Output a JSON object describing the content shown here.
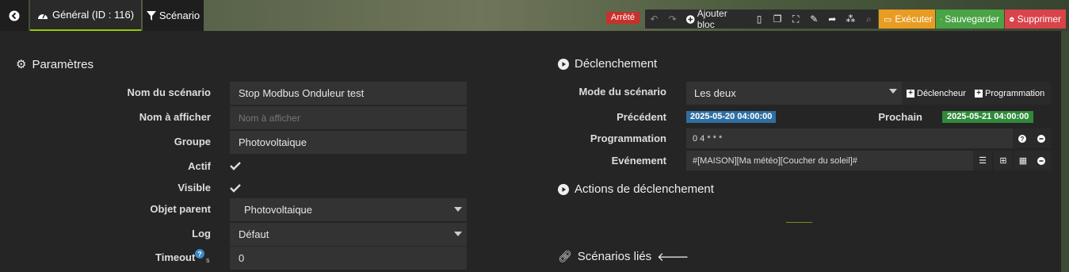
{
  "tabs": {
    "general_label": "Général (ID : 116)",
    "scenario_label": "Scénario"
  },
  "toolbar": {
    "state_badge": "Arrêté",
    "add_block_label": "Ajouter bloc",
    "execute_label": "Exécuter",
    "save_label": "Sauvegarder",
    "delete_label": "Supprimer"
  },
  "parameters": {
    "title": "Paramètres",
    "scenario_name_label": "Nom du scénario",
    "scenario_name_value": "Stop Modbus Onduleur test",
    "display_name_label": "Nom à afficher",
    "display_name_placeholder": "Nom à afficher",
    "group_label": "Groupe",
    "group_value": "Photovoltaique",
    "active_label": "Actif",
    "visible_label": "Visible",
    "parent_label": "Objet parent",
    "parent_value": "Photovoltaique",
    "log_label": "Log",
    "log_value": "Défaut",
    "timeout_label": "Timeout",
    "timeout_unit": "s",
    "timeout_value": "0"
  },
  "trigger": {
    "title": "Déclenchement",
    "mode_label": "Mode du scénario",
    "mode_value": "Les deux",
    "trigger_btn": "Déclencheur",
    "schedule_btn": "Programmation",
    "previous_label": "Précédent",
    "previous_value": "2025-05-20 04:00:00",
    "next_label": "Prochain",
    "next_value": "2025-05-21 04:00:00",
    "schedule_label": "Programmation",
    "schedule_value": "0 4 * * *",
    "event_label": "Evénement",
    "event_value": "#[MAISON][Ma météo][Coucher du soleil]#",
    "actions_title": "Actions de déclenchement",
    "linked_title": "Scénarios liés"
  },
  "colors": {
    "execute": "#e89c22",
    "save": "#4aa345",
    "delete": "#d9434a",
    "state_badge": "#c9302c",
    "previous_badge": "#2f6ea3",
    "next_badge": "#2f8a3a",
    "tab_active_underline": "#94ca02"
  }
}
